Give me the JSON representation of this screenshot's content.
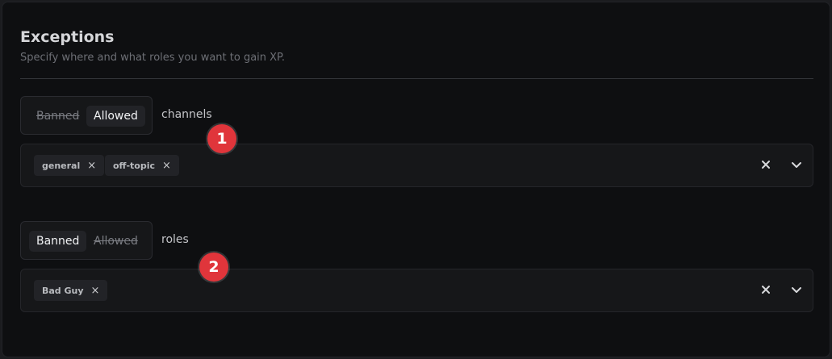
{
  "section": {
    "title": "Exceptions",
    "subtitle": "Specify where and what roles you want to gain XP."
  },
  "channels": {
    "toggle": {
      "banned_label": "Banned",
      "allowed_label": "Allowed",
      "selected": "Allowed"
    },
    "label": "channels",
    "chips": [
      {
        "label": "general",
        "remove_icon": "close-icon"
      },
      {
        "label": "off-topic",
        "remove_icon": "close-icon"
      }
    ],
    "badge": "1"
  },
  "roles": {
    "toggle": {
      "banned_label": "Banned",
      "allowed_label": "Allowed",
      "selected": "Banned"
    },
    "label": "roles",
    "chips": [
      {
        "label": "Bad Guy",
        "remove_icon": "close-icon"
      }
    ],
    "badge": "2"
  },
  "icons": {
    "clear": "clear-all-icon",
    "expand": "chevron-down-icon"
  },
  "colors": {
    "badge": "#e0353b",
    "background": "#0e0f11",
    "chip": "#222327"
  }
}
